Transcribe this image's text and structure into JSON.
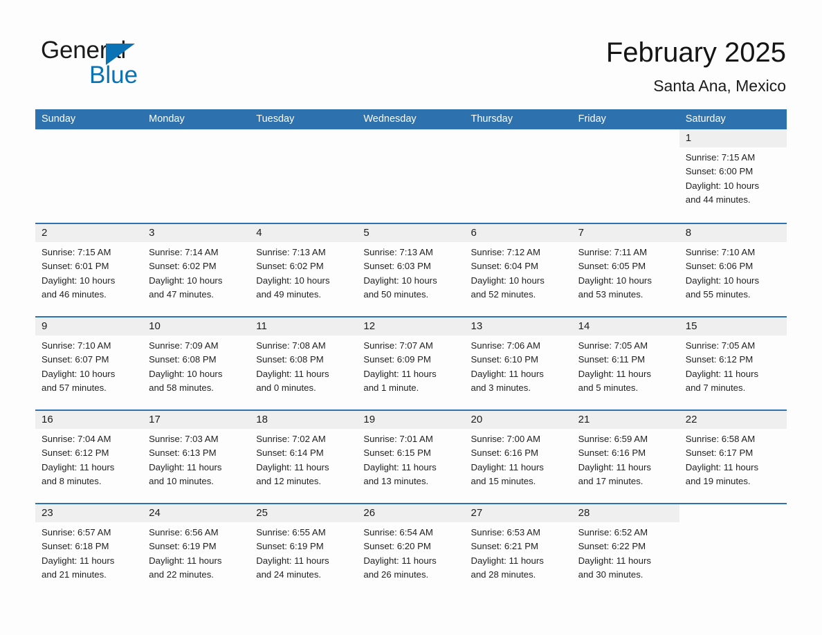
{
  "brand": {
    "name_part1": "General",
    "name_part2": "Blue",
    "triangle_icon": "triangle-icon",
    "accent_color": "#0b72b5",
    "text_color": "#1a1a1a"
  },
  "header": {
    "title": "February 2025",
    "subtitle": "Santa Ana, Mexico"
  },
  "theme": {
    "header_blue": "#2d71ae",
    "row_separator_blue": "#2d71ae",
    "daynum_band_gray": "#efefef",
    "page_background": "#fdfdfd"
  },
  "calendar": {
    "weekday_headers": [
      "Sunday",
      "Monday",
      "Tuesday",
      "Wednesday",
      "Thursday",
      "Friday",
      "Saturday"
    ],
    "labels": {
      "sunrise": "Sunrise:",
      "sunset": "Sunset:",
      "daylight": "Daylight:"
    },
    "weeks": [
      [
        {
          "blank": true
        },
        {
          "blank": true
        },
        {
          "blank": true
        },
        {
          "blank": true
        },
        {
          "blank": true
        },
        {
          "blank": true
        },
        {
          "day": "1",
          "sunrise": "Sunrise: 7:15 AM",
          "sunset": "Sunset: 6:00 PM",
          "daylight_line1": "Daylight: 10 hours",
          "daylight_line2": "and 44 minutes."
        }
      ],
      [
        {
          "day": "2",
          "sunrise": "Sunrise: 7:15 AM",
          "sunset": "Sunset: 6:01 PM",
          "daylight_line1": "Daylight: 10 hours",
          "daylight_line2": "and 46 minutes."
        },
        {
          "day": "3",
          "sunrise": "Sunrise: 7:14 AM",
          "sunset": "Sunset: 6:02 PM",
          "daylight_line1": "Daylight: 10 hours",
          "daylight_line2": "and 47 minutes."
        },
        {
          "day": "4",
          "sunrise": "Sunrise: 7:13 AM",
          "sunset": "Sunset: 6:02 PM",
          "daylight_line1": "Daylight: 10 hours",
          "daylight_line2": "and 49 minutes."
        },
        {
          "day": "5",
          "sunrise": "Sunrise: 7:13 AM",
          "sunset": "Sunset: 6:03 PM",
          "daylight_line1": "Daylight: 10 hours",
          "daylight_line2": "and 50 minutes."
        },
        {
          "day": "6",
          "sunrise": "Sunrise: 7:12 AM",
          "sunset": "Sunset: 6:04 PM",
          "daylight_line1": "Daylight: 10 hours",
          "daylight_line2": "and 52 minutes."
        },
        {
          "day": "7",
          "sunrise": "Sunrise: 7:11 AM",
          "sunset": "Sunset: 6:05 PM",
          "daylight_line1": "Daylight: 10 hours",
          "daylight_line2": "and 53 minutes."
        },
        {
          "day": "8",
          "sunrise": "Sunrise: 7:10 AM",
          "sunset": "Sunset: 6:06 PM",
          "daylight_line1": "Daylight: 10 hours",
          "daylight_line2": "and 55 minutes."
        }
      ],
      [
        {
          "day": "9",
          "sunrise": "Sunrise: 7:10 AM",
          "sunset": "Sunset: 6:07 PM",
          "daylight_line1": "Daylight: 10 hours",
          "daylight_line2": "and 57 minutes."
        },
        {
          "day": "10",
          "sunrise": "Sunrise: 7:09 AM",
          "sunset": "Sunset: 6:08 PM",
          "daylight_line1": "Daylight: 10 hours",
          "daylight_line2": "and 58 minutes."
        },
        {
          "day": "11",
          "sunrise": "Sunrise: 7:08 AM",
          "sunset": "Sunset: 6:08 PM",
          "daylight_line1": "Daylight: 11 hours",
          "daylight_line2": "and 0 minutes."
        },
        {
          "day": "12",
          "sunrise": "Sunrise: 7:07 AM",
          "sunset": "Sunset: 6:09 PM",
          "daylight_line1": "Daylight: 11 hours",
          "daylight_line2": "and 1 minute."
        },
        {
          "day": "13",
          "sunrise": "Sunrise: 7:06 AM",
          "sunset": "Sunset: 6:10 PM",
          "daylight_line1": "Daylight: 11 hours",
          "daylight_line2": "and 3 minutes."
        },
        {
          "day": "14",
          "sunrise": "Sunrise: 7:05 AM",
          "sunset": "Sunset: 6:11 PM",
          "daylight_line1": "Daylight: 11 hours",
          "daylight_line2": "and 5 minutes."
        },
        {
          "day": "15",
          "sunrise": "Sunrise: 7:05 AM",
          "sunset": "Sunset: 6:12 PM",
          "daylight_line1": "Daylight: 11 hours",
          "daylight_line2": "and 7 minutes."
        }
      ],
      [
        {
          "day": "16",
          "sunrise": "Sunrise: 7:04 AM",
          "sunset": "Sunset: 6:12 PM",
          "daylight_line1": "Daylight: 11 hours",
          "daylight_line2": "and 8 minutes."
        },
        {
          "day": "17",
          "sunrise": "Sunrise: 7:03 AM",
          "sunset": "Sunset: 6:13 PM",
          "daylight_line1": "Daylight: 11 hours",
          "daylight_line2": "and 10 minutes."
        },
        {
          "day": "18",
          "sunrise": "Sunrise: 7:02 AM",
          "sunset": "Sunset: 6:14 PM",
          "daylight_line1": "Daylight: 11 hours",
          "daylight_line2": "and 12 minutes."
        },
        {
          "day": "19",
          "sunrise": "Sunrise: 7:01 AM",
          "sunset": "Sunset: 6:15 PM",
          "daylight_line1": "Daylight: 11 hours",
          "daylight_line2": "and 13 minutes."
        },
        {
          "day": "20",
          "sunrise": "Sunrise: 7:00 AM",
          "sunset": "Sunset: 6:16 PM",
          "daylight_line1": "Daylight: 11 hours",
          "daylight_line2": "and 15 minutes."
        },
        {
          "day": "21",
          "sunrise": "Sunrise: 6:59 AM",
          "sunset": "Sunset: 6:16 PM",
          "daylight_line1": "Daylight: 11 hours",
          "daylight_line2": "and 17 minutes."
        },
        {
          "day": "22",
          "sunrise": "Sunrise: 6:58 AM",
          "sunset": "Sunset: 6:17 PM",
          "daylight_line1": "Daylight: 11 hours",
          "daylight_line2": "and 19 minutes."
        }
      ],
      [
        {
          "day": "23",
          "sunrise": "Sunrise: 6:57 AM",
          "sunset": "Sunset: 6:18 PM",
          "daylight_line1": "Daylight: 11 hours",
          "daylight_line2": "and 21 minutes."
        },
        {
          "day": "24",
          "sunrise": "Sunrise: 6:56 AM",
          "sunset": "Sunset: 6:19 PM",
          "daylight_line1": "Daylight: 11 hours",
          "daylight_line2": "and 22 minutes."
        },
        {
          "day": "25",
          "sunrise": "Sunrise: 6:55 AM",
          "sunset": "Sunset: 6:19 PM",
          "daylight_line1": "Daylight: 11 hours",
          "daylight_line2": "and 24 minutes."
        },
        {
          "day": "26",
          "sunrise": "Sunrise: 6:54 AM",
          "sunset": "Sunset: 6:20 PM",
          "daylight_line1": "Daylight: 11 hours",
          "daylight_line2": "and 26 minutes."
        },
        {
          "day": "27",
          "sunrise": "Sunrise: 6:53 AM",
          "sunset": "Sunset: 6:21 PM",
          "daylight_line1": "Daylight: 11 hours",
          "daylight_line2": "and 28 minutes."
        },
        {
          "day": "28",
          "sunrise": "Sunrise: 6:52 AM",
          "sunset": "Sunset: 6:22 PM",
          "daylight_line1": "Daylight: 11 hours",
          "daylight_line2": "and 30 minutes."
        },
        {
          "blank": true
        }
      ]
    ]
  }
}
